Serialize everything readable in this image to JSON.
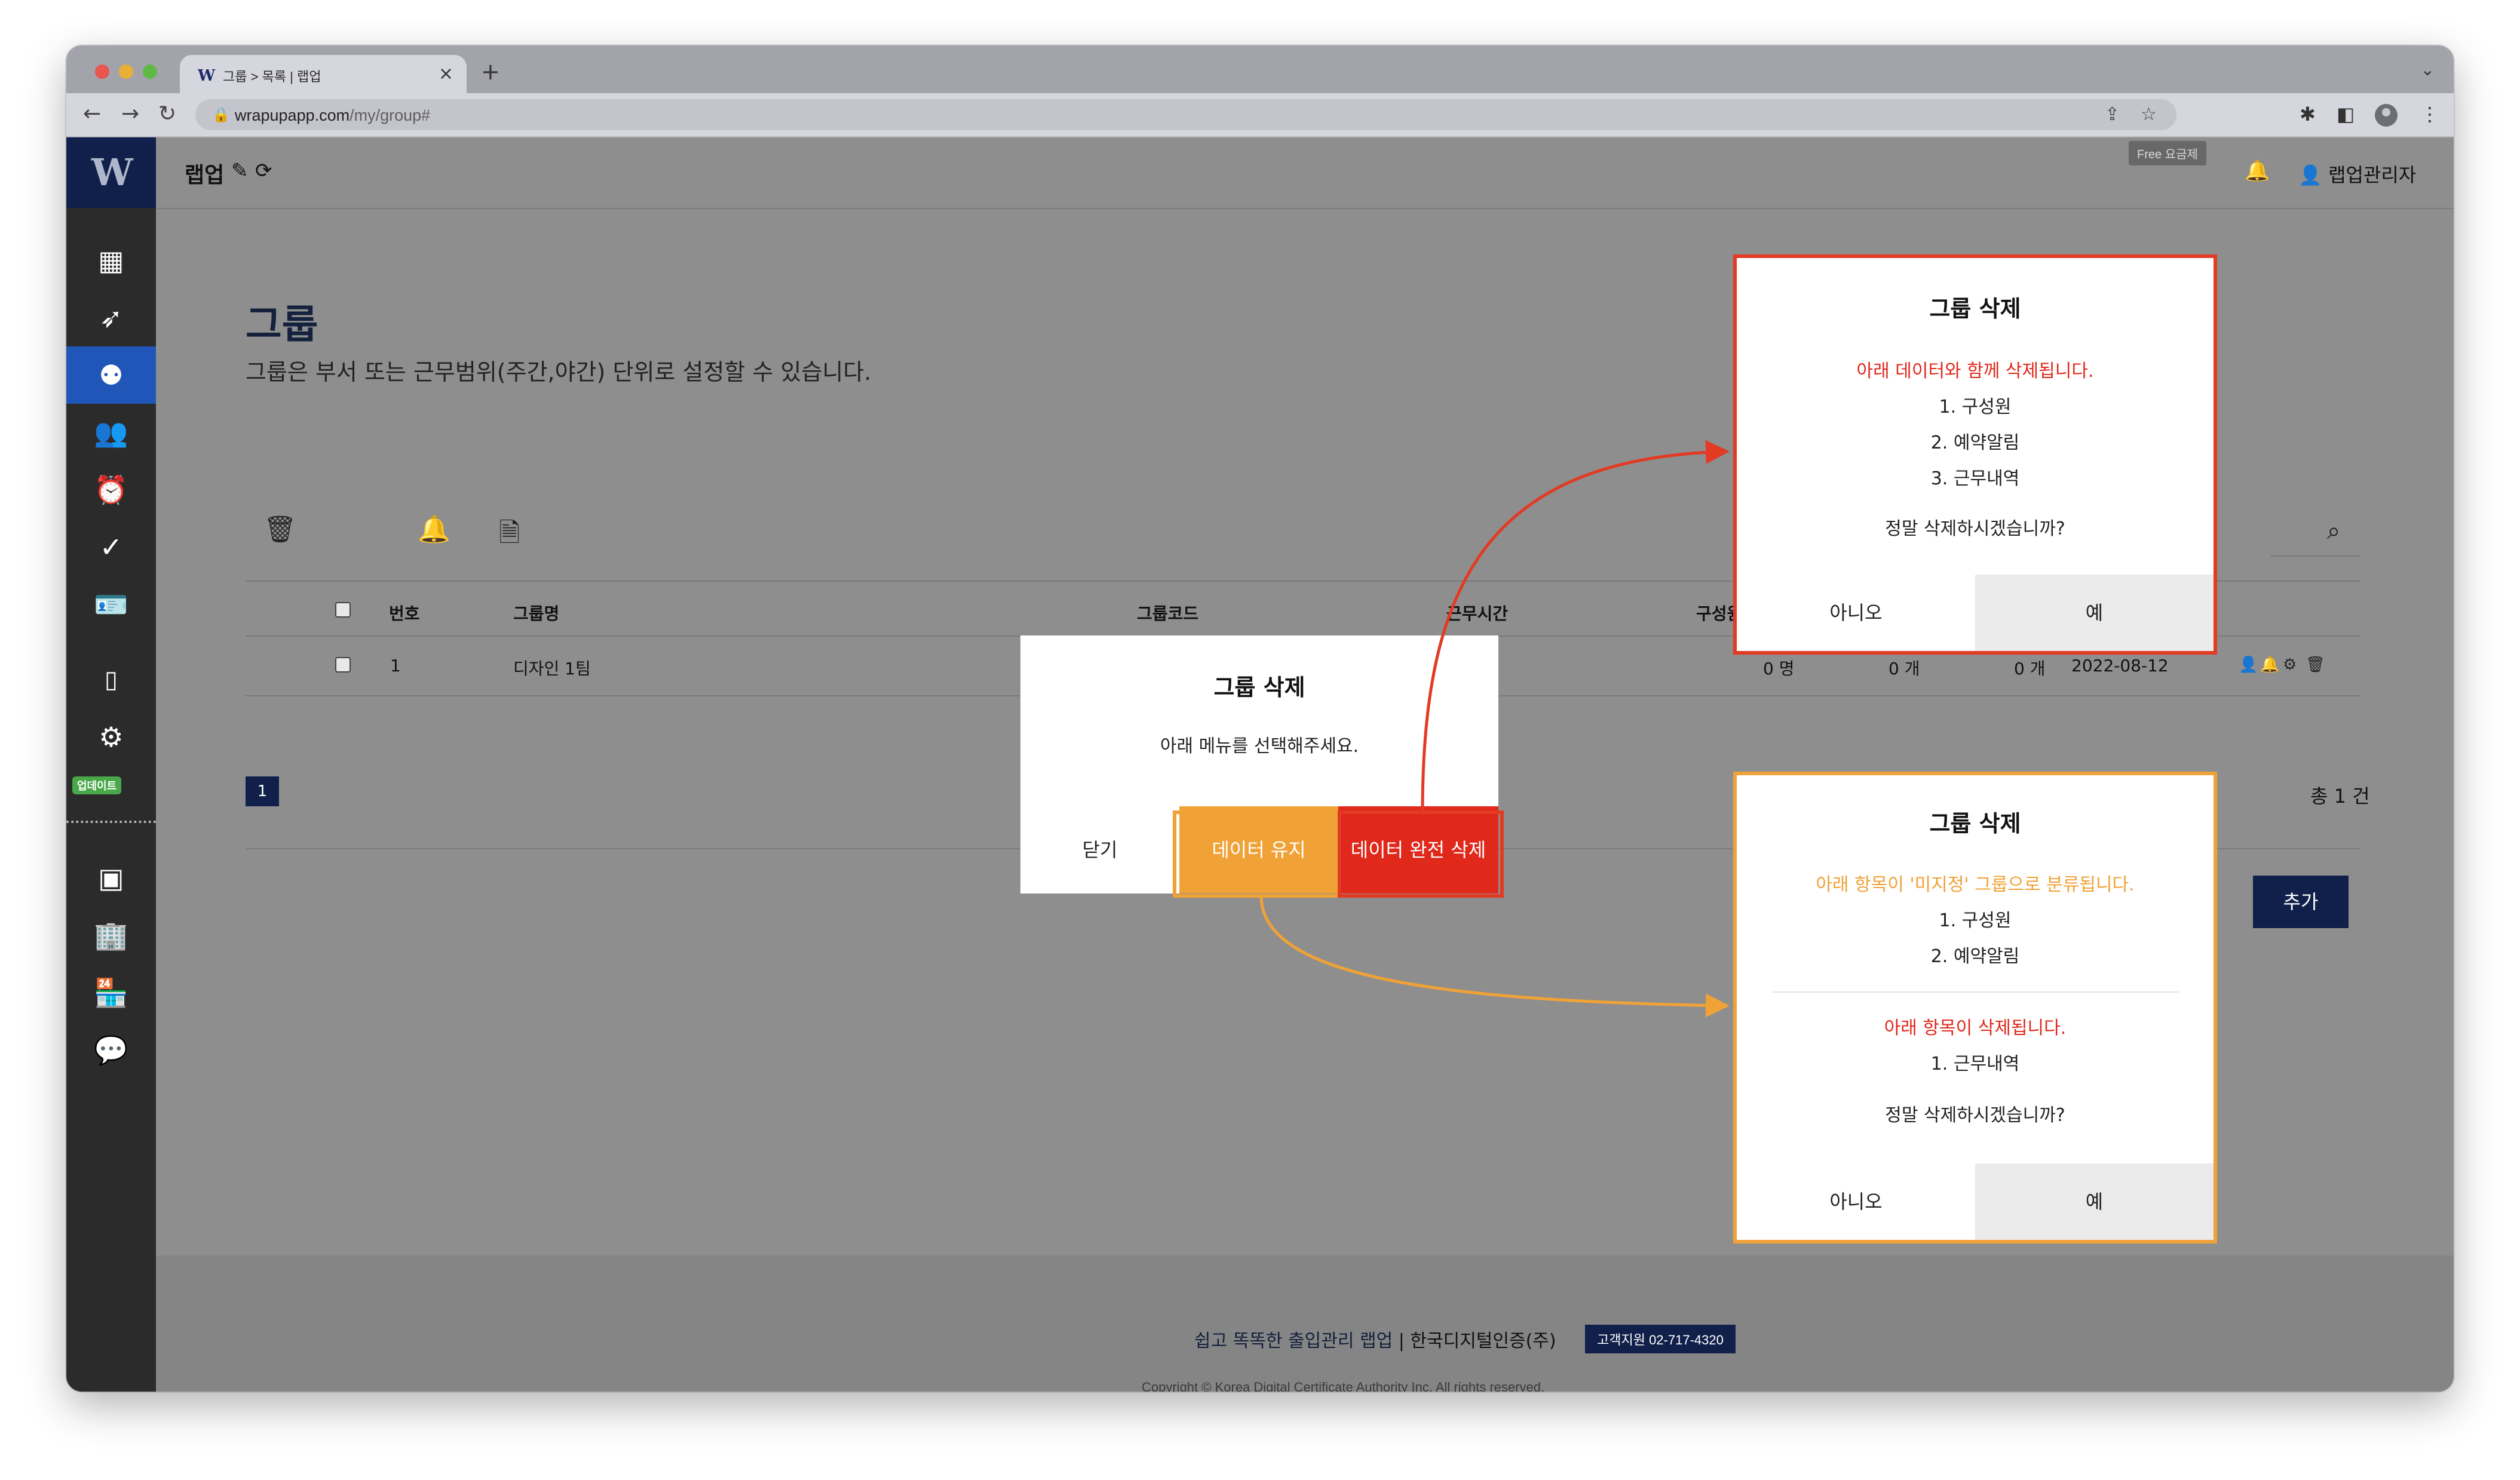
{
  "browser": {
    "tab_title": "그룹 > 목록 | 랩업",
    "tab_favicon": "W",
    "tab_close": "×",
    "new_tab": "+",
    "url_host": "wrapupapp.com",
    "url_path": "/my/group#"
  },
  "sidebar": {
    "logo": "W",
    "update_badge": "업데이트",
    "items": [
      "dashboard-icon",
      "rocket-icon",
      "group-icon",
      "people-icon",
      "alarm-icon",
      "check-icon",
      "id-card-icon",
      "phone-icon",
      "settings-icon",
      "contact-icon",
      "building-icon",
      "store-icon",
      "chat-icon"
    ]
  },
  "header": {
    "brand": "랩업",
    "plan_badge": "Free 요금제",
    "user_name": "랩업관리자"
  },
  "page": {
    "title": "그룹",
    "description": "그룹은 부서 또는 근무범위(주간,야간) 단위로 설정할 수 있습니다."
  },
  "table": {
    "headers": {
      "number": "번호",
      "name": "그룹명",
      "code": "그룹코드",
      "work_time": "근무시간",
      "members": "구성원 수"
    },
    "rows": [
      {
        "number": "1",
        "name": "디자인 1팀",
        "members": "0 명",
        "col5": "0 개",
        "col6": "0 개",
        "date": "2022-08-12"
      }
    ]
  },
  "pagination": {
    "current": "1",
    "total": "총 1 건"
  },
  "add_button": "추가",
  "footer": {
    "slogan": "쉽고 똑똑한 출입관리 랩업",
    "company": " | 한국디지털인증(주)",
    "support": "고객지원 02-717-4320",
    "copyright": "Copyright © Korea Digital Certificate Authority Inc. All rights reserved."
  },
  "center_modal": {
    "title": "그룹 삭제",
    "message": "아래 메뉴를 선택해주세요.",
    "close_label": "닫기",
    "keep_label": "데이터 유지",
    "delete_all_label": "데이터 완전 삭제"
  },
  "red_modal": {
    "title": "그룹 삭제",
    "warning": "아래 데이터와 함께 삭제됩니다.",
    "items": [
      "1. 구성원",
      "2. 예약알림",
      "3. 근무내역"
    ],
    "confirm": "정말 삭제하시겠습니까?",
    "no_label": "아니오",
    "yes_label": "예"
  },
  "orange_modal": {
    "title": "그룹 삭제",
    "notice": "아래 항목이 '미지정' 그룹으로 분류됩니다.",
    "moved_items": [
      "1. 구성원",
      "2. 예약알림"
    ],
    "warning": "아래 항목이 삭제됩니다.",
    "deleted_items": [
      "1. 근무내역"
    ],
    "confirm": "정말 삭제하시겠습니까?",
    "no_label": "아니오",
    "yes_label": "예"
  },
  "colors": {
    "brand_navy": "#10204a",
    "active_blue": "#2056b8",
    "danger_red": "#e0281b",
    "keep_orange": "#f0a236"
  }
}
